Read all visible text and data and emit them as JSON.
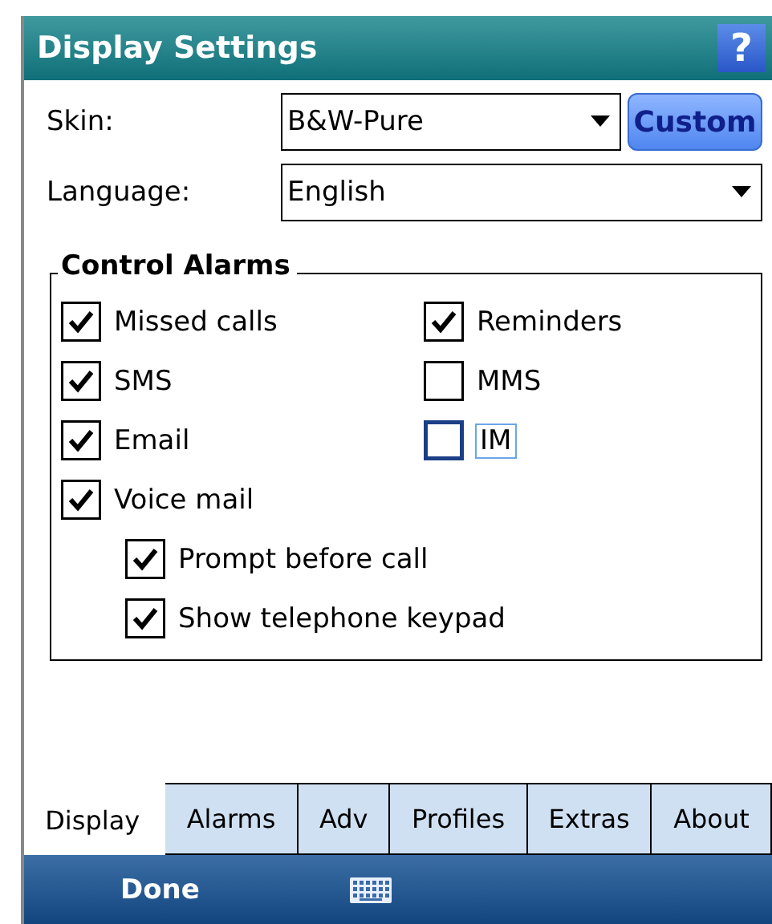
{
  "window": {
    "title": "Display Settings",
    "help": "?"
  },
  "fields": [
    {
      "label": "Skin:",
      "value": "B&W-Pure",
      "button": "Custom"
    },
    {
      "label": "Language:",
      "value": "English"
    }
  ],
  "group": {
    "title": "Control Alarms",
    "left_column": [
      {
        "label": "Missed calls",
        "checked": true,
        "focused": false
      },
      {
        "label": "SMS",
        "checked": true,
        "focused": false
      },
      {
        "label": "Email",
        "checked": true,
        "focused": false
      },
      {
        "label": "Voice mail",
        "checked": true,
        "focused": false,
        "children": [
          {
            "label": "Prompt before call",
            "checked": true,
            "focused": false
          },
          {
            "label": "Show telephone keypad",
            "checked": true,
            "focused": false
          }
        ]
      }
    ],
    "right_column": [
      {
        "label": "Reminders",
        "checked": true,
        "focused": false
      },
      {
        "label": "MMS",
        "checked": false,
        "focused": false
      },
      {
        "label": "IM",
        "checked": false,
        "focused": true
      }
    ]
  },
  "tabs": [
    {
      "label": "Display",
      "selected": true
    },
    {
      "label": "Alarms",
      "selected": false
    },
    {
      "label": "Adv",
      "selected": false
    },
    {
      "label": "Profiles",
      "selected": false
    },
    {
      "label": "Extras",
      "selected": false
    },
    {
      "label": "About",
      "selected": false
    }
  ],
  "menu_bar": {
    "left": "Done"
  }
}
